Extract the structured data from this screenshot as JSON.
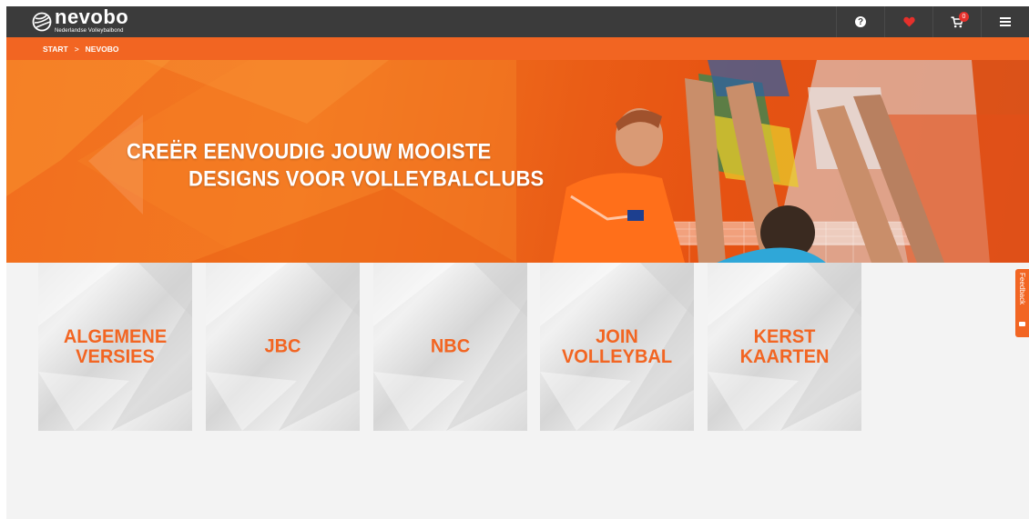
{
  "header": {
    "logo_word": "nevobo",
    "logo_tagline": "Nederlandse Volleybalbond",
    "cart_count": "0",
    "help_symbol": "?",
    "icons": [
      "help-icon",
      "heart-icon",
      "cart-icon",
      "menu-icon"
    ]
  },
  "breadcrumb": {
    "items": [
      "START",
      "NEVOBO"
    ],
    "separator": ">"
  },
  "hero": {
    "line1": "CREËR EENVOUDIG JOUW MOOISTE",
    "line2": "DESIGNS VOOR VOLLEYBALCLUBS"
  },
  "tiles": [
    {
      "label": "ALGEMENE\nVERSIES"
    },
    {
      "label": "JBC"
    },
    {
      "label": "NBC"
    },
    {
      "label": "JOIN\nVOLLEYBAL"
    },
    {
      "label": "KERST\nKAARTEN"
    }
  ],
  "feedback": {
    "label": "Feedback"
  },
  "colors": {
    "brand_orange": "#f26522",
    "header_dark": "#3b3b3b",
    "heart_red": "#e5302b",
    "page_bg": "#f3f3f3"
  }
}
